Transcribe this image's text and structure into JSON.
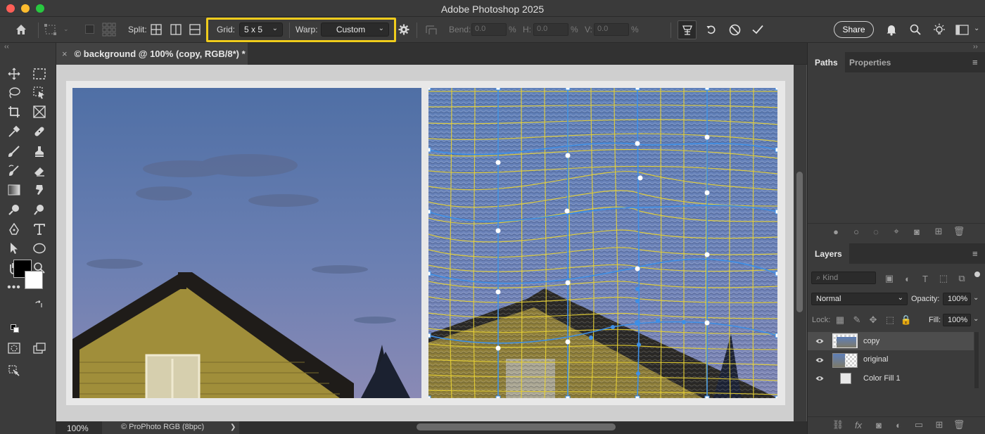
{
  "window": {
    "title": "Adobe Photoshop 2025"
  },
  "options_bar": {
    "split_label": "Split:",
    "grid_label": "Grid:",
    "grid_value": "5 x 5",
    "warp_label": "Warp:",
    "warp_value": "Custom",
    "bend_label": "Bend:",
    "bend_value": "0.0",
    "h_label": "H:",
    "h_value": "0.0",
    "v_label": "V:",
    "v_value": "0.0",
    "percent": "%",
    "share_label": "Share",
    "highlight_color": "#f0cc1c"
  },
  "document": {
    "tab_title": "© background @ 100% (copy, RGB/8*) *",
    "close_glyph": "×"
  },
  "status": {
    "zoom": "100%",
    "profile": "© ProPhoto RGB (8bpc)",
    "chevron": "❯"
  },
  "panels": {
    "top_tabs": [
      "Paths",
      "Properties"
    ],
    "menu_glyph": "≡",
    "layers_tab": "Layers",
    "kind_placeholder": "Kind",
    "blend_mode": "Normal",
    "opacity_label": "Opacity:",
    "opacity_value": "100%",
    "lock_label": "Lock:",
    "fill_label": "Fill:",
    "fill_value": "100%",
    "layers": [
      {
        "name": "copy",
        "selected": true
      },
      {
        "name": "original",
        "selected": false
      },
      {
        "name": "Color Fill 1",
        "selected": false
      }
    ]
  },
  "colors": {
    "grid_yellow": "#e8d233",
    "grid_blue": "#3d8fe6",
    "foreground": "#000000",
    "background": "#ffffff"
  }
}
